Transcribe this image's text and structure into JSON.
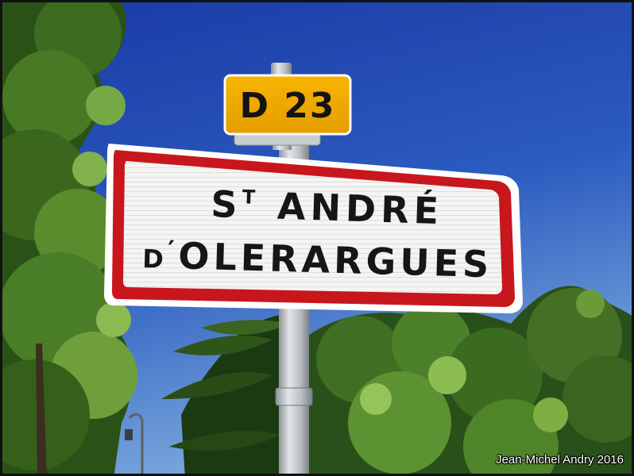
{
  "photo": {
    "colors": {
      "sky_top": "#1c3ea8",
      "sky_bottom": "#6f9fd8",
      "foliage_dark": "#1f3d14",
      "foliage_mid": "#3f6e22",
      "foliage_light": "#7fae43",
      "sign_border": "#c8161d",
      "plate_yellow": "#f2a900",
      "pole": "#c8cdd0"
    },
    "road_plate": {
      "text": "D 23"
    },
    "town_sign": {
      "line1_prefix": "S",
      "line1_superscript": "T",
      "line1_main": " ANDRÉ",
      "line2_prefix": "D",
      "line2_apostrophe": "′",
      "line2_main": "OLERARGUES"
    },
    "credit": "Jean-Michel Andry 2016"
  }
}
